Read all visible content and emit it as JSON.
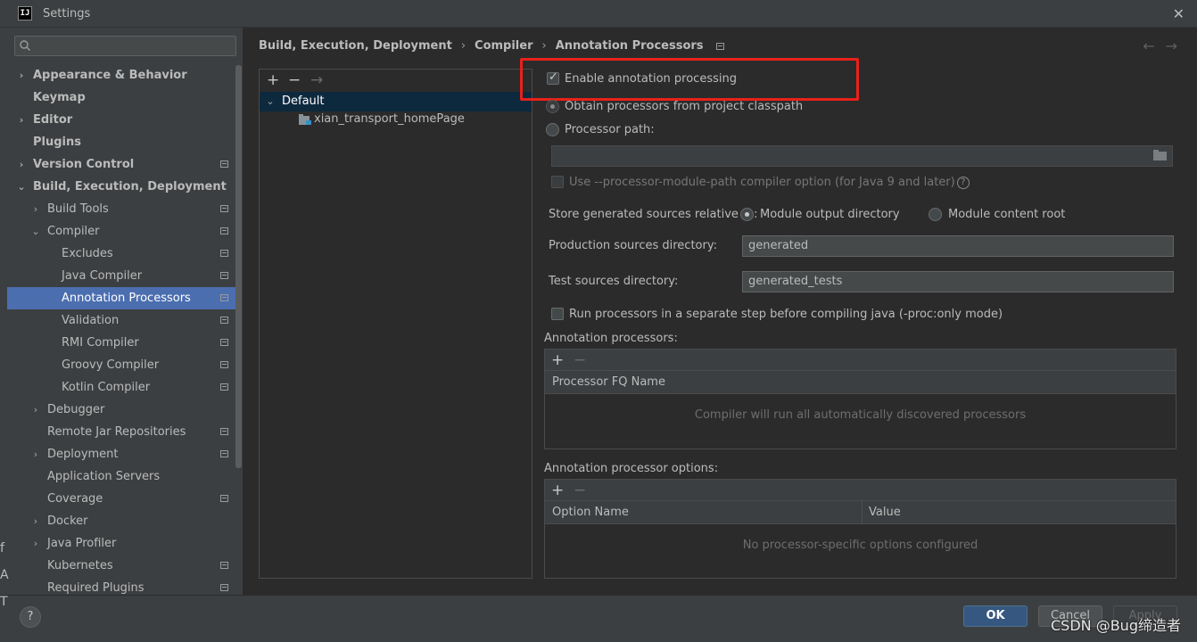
{
  "window": {
    "title": "Settings",
    "close_glyph": "✕"
  },
  "app_icon": "IJ",
  "search": {
    "placeholder": ""
  },
  "sidebar": {
    "items": [
      {
        "label": "Appearance & Behavior",
        "chevron": "›",
        "bold": true
      },
      {
        "label": "Keymap",
        "bold": true
      },
      {
        "label": "Editor",
        "chevron": "›",
        "bold": true
      },
      {
        "label": "Plugins",
        "bold": true
      },
      {
        "label": "Version Control",
        "chevron": "›",
        "bold": true
      },
      {
        "label": "Build, Execution, Deployment",
        "chevron": "⌄",
        "bold": true
      },
      {
        "label": "Build Tools",
        "chevron": "›"
      },
      {
        "label": "Compiler",
        "chevron": "⌄"
      },
      {
        "label": "Excludes"
      },
      {
        "label": "Java Compiler"
      },
      {
        "label": "Annotation Processors",
        "selected": true
      },
      {
        "label": "Validation"
      },
      {
        "label": "RMI Compiler"
      },
      {
        "label": "Groovy Compiler"
      },
      {
        "label": "Kotlin Compiler"
      },
      {
        "label": "Debugger",
        "chevron": "›"
      },
      {
        "label": "Remote Jar Repositories"
      },
      {
        "label": "Deployment",
        "chevron": "›"
      },
      {
        "label": "Application Servers"
      },
      {
        "label": "Coverage"
      },
      {
        "label": "Docker",
        "chevron": "›"
      },
      {
        "label": "Java Profiler",
        "chevron": "›"
      },
      {
        "label": "Kubernetes"
      },
      {
        "label": "Required Plugins"
      }
    ]
  },
  "breadcrumb": {
    "items": [
      "Build, Execution, Deployment",
      "Compiler",
      "Annotation Processors"
    ],
    "separator": "›"
  },
  "nav": {
    "back": "←",
    "forward": "→"
  },
  "profiles": {
    "toolbar": {
      "add": "+",
      "remove": "−",
      "move": "→"
    },
    "default_label": "Default",
    "default_chevron": "⌄",
    "module_label": "xian_transport_homePage"
  },
  "settings": {
    "enable_annotation_processing": {
      "label": "Enable annotation processing",
      "checked": true
    },
    "obtain_from_classpath": {
      "label": "Obtain processors from project classpath"
    },
    "processor_path": {
      "label": "Processor path:",
      "value": ""
    },
    "use_module_path": {
      "label": "Use --processor-module-path compiler option (for Java 9 and later)",
      "help": "?"
    },
    "store_generated_label": "Store generated sources relative to:",
    "module_output_directory": "Module output directory",
    "module_content_root": "Module content root",
    "production_dir": {
      "label": "Production sources directory:",
      "value": "generated"
    },
    "test_dir": {
      "label": "Test sources directory:",
      "value": "generated_tests"
    },
    "run_separate_step": {
      "label": "Run processors in a separate step before compiling java (-proc:only mode)",
      "checked": false
    },
    "annotation_processors": {
      "title": "Annotation processors:",
      "add": "+",
      "remove": "−",
      "column": "Processor FQ Name",
      "empty": "Compiler will run all automatically discovered processors"
    },
    "processor_options": {
      "title": "Annotation processor options:",
      "add": "+",
      "remove": "−",
      "columns": [
        "Option Name",
        "Value"
      ],
      "empty": "No processor-specific options configured"
    }
  },
  "buttons": {
    "help": "?",
    "ok": "OK",
    "cancel": "Cancel",
    "apply": "Apply"
  },
  "watermark": "CSDN @Bug缔造者",
  "edge_letters": [
    "f",
    "A",
    "T"
  ],
  "colors": {
    "selection": "#4b6eaf",
    "highlight_box": "#e8211a",
    "ok_button": "#365880"
  }
}
